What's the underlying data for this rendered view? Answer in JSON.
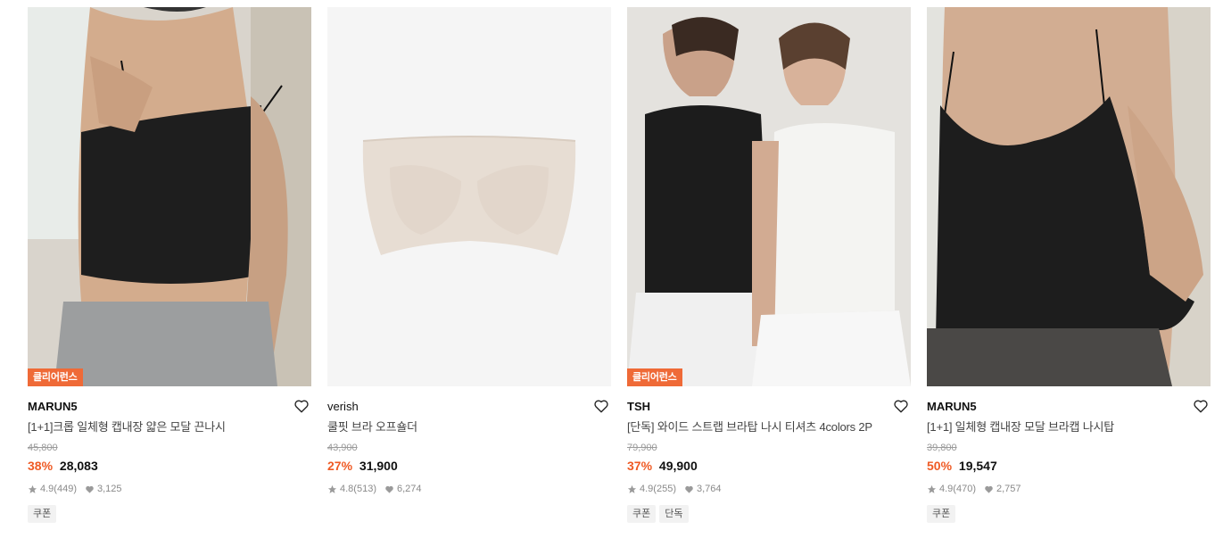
{
  "products": [
    {
      "badge": "클리어런스",
      "brand": "MARUN5",
      "title": "[1+1]크롭 일체형 캡내장 얇은 모달 끈나시",
      "original_price": "45,800",
      "discount": "38%",
      "price": "28,083",
      "rating": "4.9",
      "reviews": "(449)",
      "likes": "3,125",
      "tags": [
        "쿠폰"
      ],
      "image_icon": "black-crop-camisole-photo"
    },
    {
      "badge": "",
      "brand": "verish",
      "title": "쿨핏 브라 오프숄더",
      "original_price": "43,900",
      "discount": "27%",
      "price": "31,900",
      "rating": "4.8",
      "reviews": "(513)",
      "likes": "6,274",
      "tags": [],
      "image_icon": "beige-strapless-bra-photo"
    },
    {
      "badge": "클리어런스",
      "brand": "TSH",
      "title": "[단독] 와이드 스트랩 브라탑 나시 티셔츠 4colors 2P",
      "original_price": "79,900",
      "discount": "37%",
      "price": "49,900",
      "rating": "4.9",
      "reviews": "(255)",
      "likes": "3,764",
      "tags": [
        "쿠폰",
        "단독"
      ],
      "image_icon": "two-models-tank-tops-photo"
    },
    {
      "badge": "",
      "brand": "MARUN5",
      "title": "[1+1] 일체형 캡내장 모달 브라캡 나시탑",
      "original_price": "39,800",
      "discount": "50%",
      "price": "19,547",
      "rating": "4.9",
      "reviews": "(470)",
      "likes": "2,757",
      "tags": [
        "쿠폰"
      ],
      "image_icon": "black-camisole-top-photo"
    }
  ],
  "colors": {
    "badge_bg": "#ef6a37",
    "discount": "#ef5b25",
    "tag_bg": "#f2f2f2"
  }
}
